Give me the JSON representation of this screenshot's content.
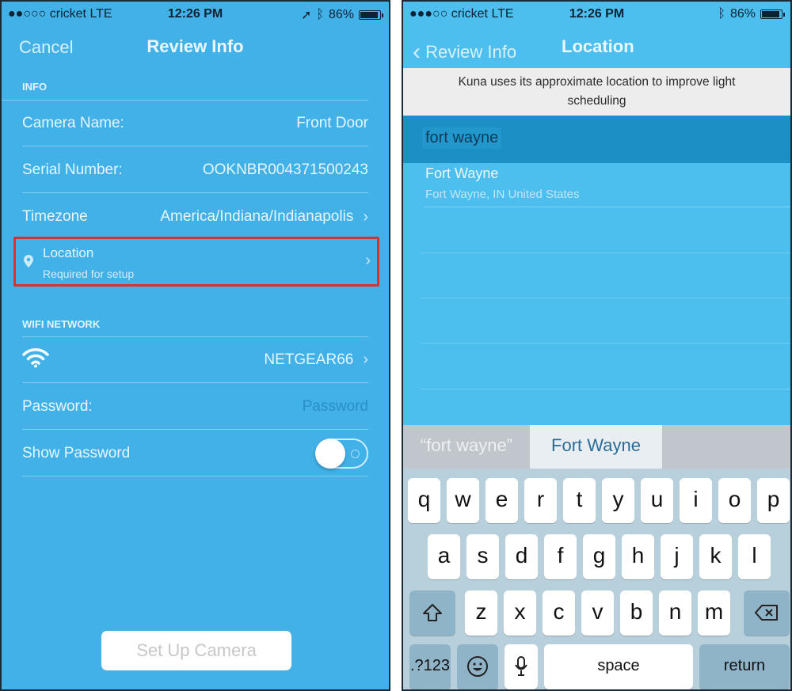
{
  "left_screen": {
    "status": {
      "carrier": "●●○○○ cricket  LTE",
      "time": "12:26 PM",
      "battery": "86%",
      "battery_level": 0.86
    },
    "nav": {
      "cancel": "Cancel",
      "title": "Review Info"
    },
    "info_section": {
      "header": "INFO",
      "rows": [
        {
          "label": "Camera Name:",
          "value": "Front Door"
        },
        {
          "label": "Serial Number:",
          "value": "OOKNBR004371500243"
        },
        {
          "label": "Timezone",
          "value": "America/Indiana/Indianapolis"
        }
      ],
      "location": {
        "title": "Location",
        "subtitle": "Required for setup"
      }
    },
    "wifi_section": {
      "header": "WIFI NETWORK",
      "network": "NETGEAR66",
      "password_label": "Password:",
      "password_placeholder": "Password",
      "show_password_label": "Show Password",
      "show_password_on": false
    },
    "setup_button": "Set Up Camera"
  },
  "right_screen": {
    "status": {
      "carrier": "●●●○○ cricket  LTE",
      "time": "12:26 PM",
      "battery": "86%",
      "battery_level": 0.86
    },
    "nav": {
      "back": "Review Info",
      "title": "Location"
    },
    "banner": "Kuna uses its approximate location to improve light scheduling",
    "search_value": "fort wayne",
    "results": [
      {
        "title": "Fort Wayne",
        "subtitle": "Fort Wayne, IN United States"
      }
    ],
    "suggestions": [
      "“fort wayne”",
      "Fort Wayne"
    ],
    "keyboard": {
      "row1": [
        "q",
        "w",
        "e",
        "r",
        "t",
        "y",
        "u",
        "i",
        "o",
        "p"
      ],
      "row2": [
        "a",
        "s",
        "d",
        "f",
        "g",
        "h",
        "j",
        "k",
        "l"
      ],
      "row3": [
        "z",
        "x",
        "c",
        "v",
        "b",
        "n",
        "m"
      ],
      "numbers": ".?123",
      "space": "space",
      "return": "return"
    }
  },
  "colors": {
    "accent_blue": "#41b1e8",
    "highlight_red": "#d93030",
    "search_bar": "#1c8fc4"
  }
}
